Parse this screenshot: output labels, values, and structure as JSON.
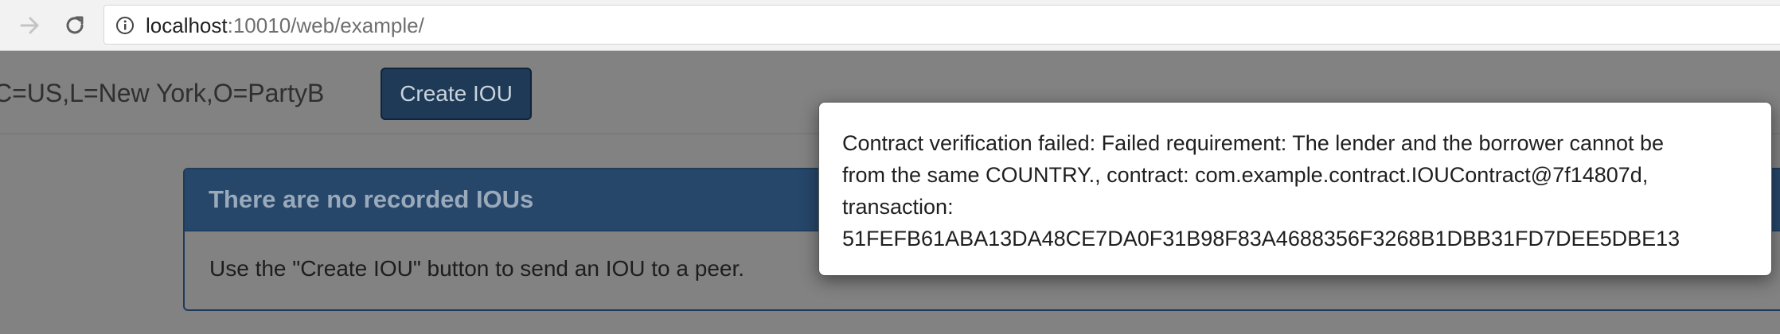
{
  "browser": {
    "url_host": "localhost",
    "url_rest": ":10010/web/example/"
  },
  "app": {
    "header": {
      "peer_name": "C=US,L=New York,O=PartyB",
      "create_button_label": "Create IOU"
    },
    "panel": {
      "title": "There are no recorded IOUs",
      "body": "Use the \"Create IOU\" button to send an IOU to a peer."
    }
  },
  "modal": {
    "lines": [
      "Contract verification failed: Failed requirement: The lender and the borrower cannot be",
      "from the same COUNTRY., contract: com.example.contract.IOUContract@7f14807d,",
      "transaction:",
      "51FEFB61ABA13DA48CE7DA0F31B98F83A4688356F3268B1DBB31FD7DEE5DBE13"
    ]
  },
  "icons": {
    "forward": "arrow-right-icon",
    "reload": "reload-icon",
    "site_info": "info-icon"
  },
  "colors": {
    "button_bg": "#1e3a57",
    "panel_heading_bg": "#26476a",
    "backdrop": "#828282"
  }
}
